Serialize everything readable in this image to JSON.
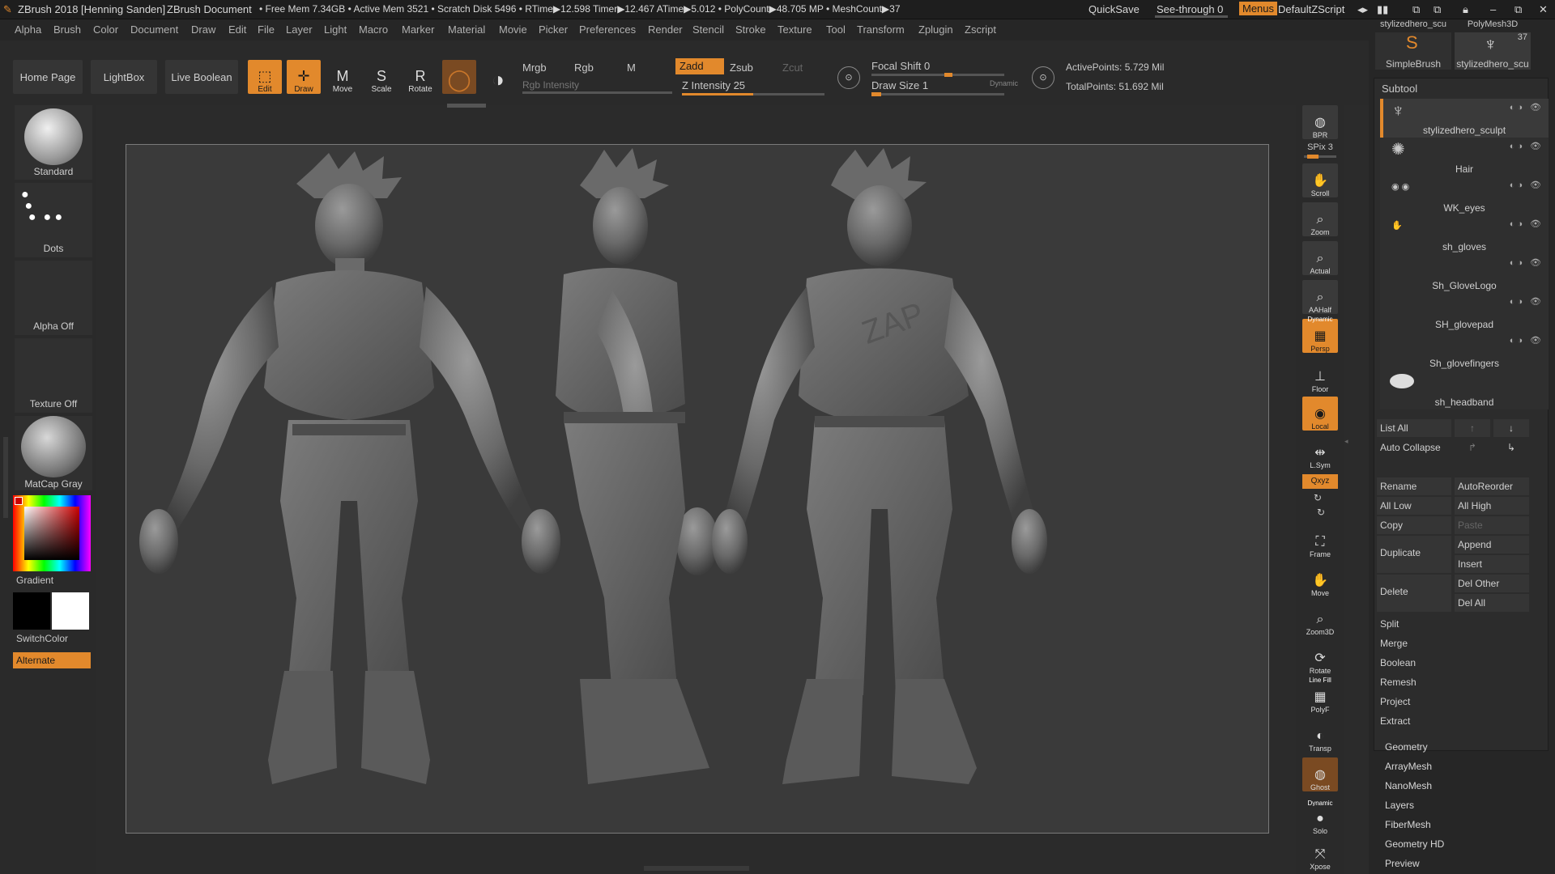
{
  "titlebar": {
    "app": "ZBrush 2018 [Henning Sanden]",
    "document": "ZBrush Document",
    "stats": "• Free Mem 7.34GB • Active Mem 3521 • Scratch Disk 5496 • RTime▶12.598 Timer▶12.467 ATime▶5.012 • PolyCount▶48.705 MP • MeshCount▶37",
    "quicksave": "QuickSave",
    "seethrough": "See-through  0",
    "menus": "Menus",
    "script": "DefaultZScript"
  },
  "menu": [
    "Alpha",
    "Brush",
    "Color",
    "Document",
    "Draw",
    "Edit",
    "File",
    "Layer",
    "Light",
    "Macro",
    "Marker",
    "Material",
    "Movie",
    "Picker",
    "Preferences",
    "Render",
    "Stencil",
    "Stroke",
    "Texture",
    "Tool",
    "Transform",
    "Zplugin",
    "Zscript"
  ],
  "toolbar": {
    "home": "Home Page",
    "lightbox": "LightBox",
    "liveboolean": "Live Boolean",
    "edit": "Edit",
    "draw": "Draw",
    "move": "Move",
    "scale": "Scale",
    "rotate": "Rotate",
    "mrgb": "Mrgb",
    "rgb": "Rgb",
    "m": "M",
    "rgb_intensity": "Rgb Intensity",
    "zadd": "Zadd",
    "zsub": "Zsub",
    "zcut": "Zcut",
    "z_intensity": "Z Intensity 25",
    "focal_shift": "Focal Shift 0",
    "draw_size": "Draw Size 1",
    "dynamic": "Dynamic",
    "active_points": "ActivePoints: 5.729 Mil",
    "total_points": "TotalPoints: 51.692 Mil"
  },
  "left_shelf": {
    "brush": "Standard",
    "stroke": "Dots",
    "alpha": "Alpha Off",
    "texture": "Texture Off",
    "material": "MatCap Gray",
    "gradient": "Gradient",
    "switchcolor": "SwitchColor",
    "alternate": "Alternate"
  },
  "right_shelf": [
    {
      "label": "BPR",
      "icon": "bpr-icon"
    },
    {
      "label": "SPix 3",
      "icon": "spix-slider"
    },
    {
      "label": "Scroll",
      "icon": "scroll-icon"
    },
    {
      "label": "Zoom",
      "icon": "zoom-icon"
    },
    {
      "label": "Actual",
      "icon": "actual-icon"
    },
    {
      "label": "AAHalf",
      "icon": "aahalf-icon"
    },
    {
      "label": "Persp",
      "icon": "persp-icon"
    },
    {
      "label": "Floor",
      "icon": "floor-icon"
    },
    {
      "label": "Local",
      "icon": "local-icon"
    },
    {
      "label": "L.Sym",
      "icon": "lsym-icon"
    },
    {
      "label": "Qxyz",
      "icon": "xyz-icon"
    },
    {
      "label": "Frame",
      "icon": "frame-icon"
    },
    {
      "label": "Move",
      "icon": "move-icon"
    },
    {
      "label": "Zoom3D",
      "icon": "zoom3d-icon"
    },
    {
      "label": "Rotate",
      "icon": "rotate-icon"
    },
    {
      "label": "PolyF",
      "icon": "polyf-icon"
    },
    {
      "label": "Transp",
      "icon": "transp-icon"
    },
    {
      "label": "Ghost",
      "icon": "ghost-icon"
    },
    {
      "label": "Solo",
      "icon": "solo-icon"
    },
    {
      "label": "Xpose",
      "icon": "xpose-icon"
    }
  ],
  "right_shelf_extra": {
    "dynamic": "Dynamic",
    "linefill": "Line Fill"
  },
  "tool_thumbs": {
    "t1_name": "stylizedhero_scu",
    "t2_name": "PolyMesh3D",
    "t3_name": "SimpleBrush",
    "t4_name": "stylizedhero_scu",
    "count": "37"
  },
  "subtool": {
    "header": "Subtool",
    "items": [
      "stylizedhero_sculpt",
      "Hair",
      "WK_eyes",
      "sh_gloves",
      "Sh_GloveLogo",
      "SH_glovepad",
      "Sh_glovefingers",
      "sh_headband"
    ]
  },
  "subtool_buttons": {
    "listall": "List All",
    "autocollapse": "Auto Collapse",
    "rename": "Rename",
    "autoreorder": "AutoReorder",
    "alllow": "All Low",
    "allhigh": "All High",
    "copy": "Copy",
    "paste": "Paste",
    "duplicate": "Duplicate",
    "append": "Append",
    "insert": "Insert",
    "delete": "Delete",
    "delother": "Del Other",
    "delall": "Del All",
    "split": "Split",
    "merge": "Merge",
    "boolean": "Boolean",
    "remesh": "Remesh",
    "project": "Project",
    "extract": "Extract"
  },
  "tool_sections": [
    "Geometry",
    "ArrayMesh",
    "NanoMesh",
    "Layers",
    "FiberMesh",
    "Geometry HD",
    "Preview"
  ],
  "colors": {
    "accent": "#e2892c",
    "bg": "#2b2b2b",
    "viewport": "#3a3a3a"
  }
}
